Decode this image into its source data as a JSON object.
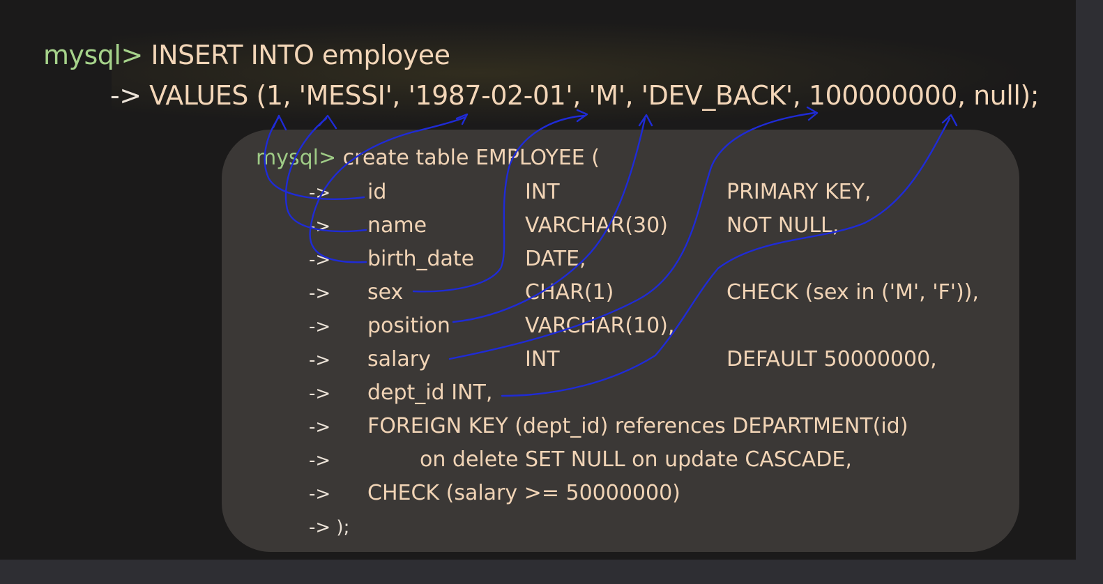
{
  "insert": {
    "prompt": "mysql>",
    "line1": " INSERT INTO employee",
    "arrow": "->",
    "line2": " VALUES (1, 'MESSI', '1987-02-01', 'M', 'DEV_BACK', 100000000, null);"
  },
  "create": {
    "prompt": "mysql>",
    "header": " create table EMPLOYEE (",
    "arrow": "->",
    "rows": [
      {
        "col": "id",
        "type": "INT",
        "constraint": "PRIMARY KEY,"
      },
      {
        "col": "name",
        "type": "VARCHAR(30)",
        "constraint": "NOT NULL,"
      },
      {
        "col": "birth_date",
        "type": "DATE,",
        "constraint": ""
      },
      {
        "col": "sex",
        "type": "CHAR(1)",
        "constraint": "CHECK (sex in ('M', 'F')),"
      },
      {
        "col": "position",
        "type": "VARCHAR(10),",
        "constraint": ""
      },
      {
        "col": "salary",
        "type": "INT",
        "constraint": "DEFAULT 50000000,"
      }
    ],
    "dept": "dept_id INT,",
    "fk": "FOREIGN KEY (dept_id) references DEPARTMENT(id)",
    "fk_action": "on delete SET NULL on update CASCADE,",
    "check": "CHECK (salary >= 50000000)",
    "close": "->  );"
  },
  "colors": {
    "background": "#1b1a1a",
    "panel": "#3b3836",
    "prompt": "#a6d38b",
    "code": "#f3d6b8",
    "ink": "#1f2bd6"
  }
}
